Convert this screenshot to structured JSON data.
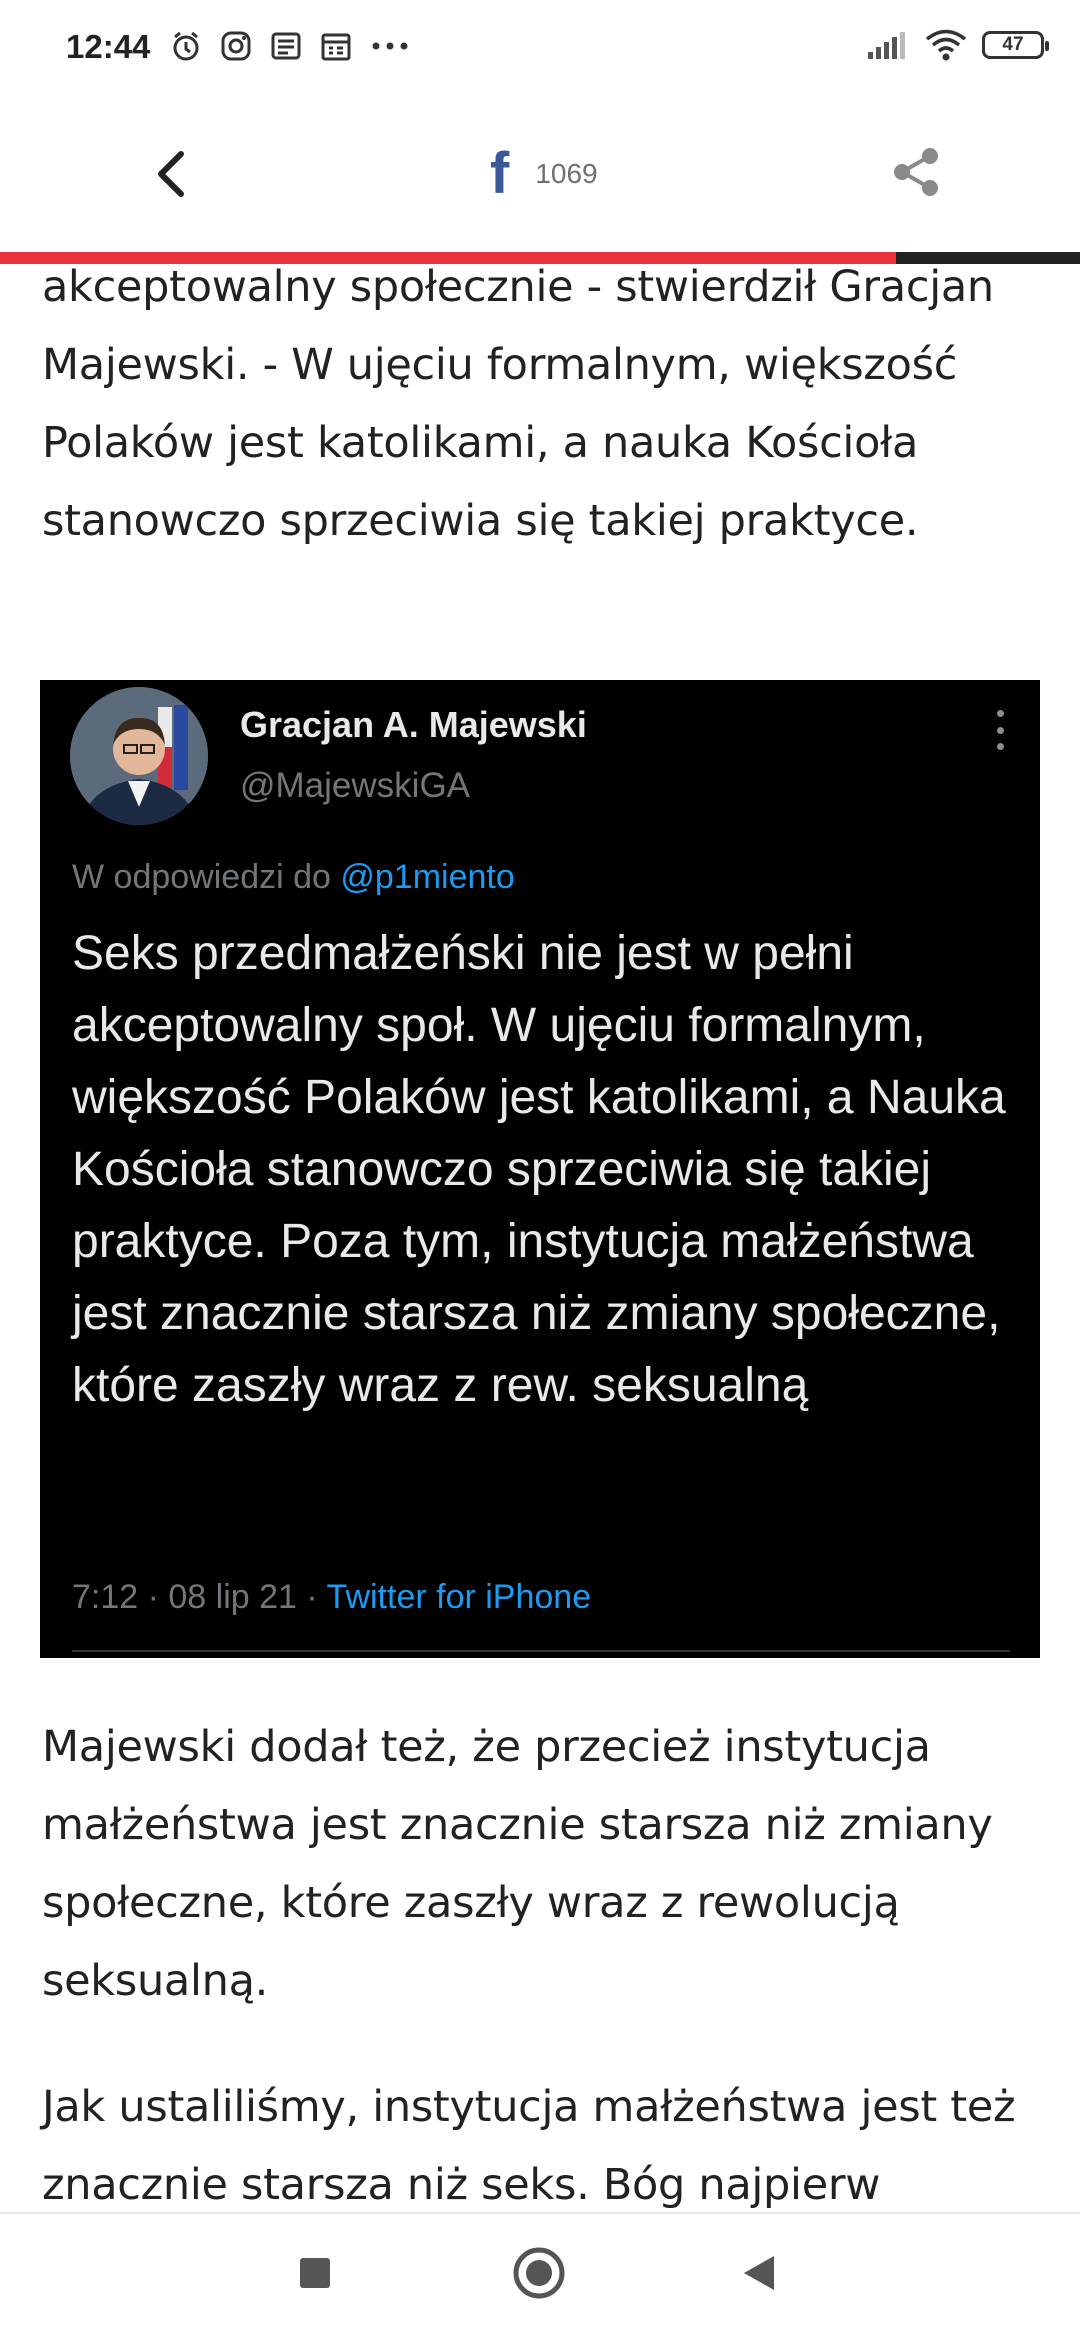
{
  "status_bar": {
    "time": "12:44",
    "battery": "47",
    "left_icons": [
      "alarm-icon",
      "instagram-icon",
      "news-icon",
      "calendar-icon",
      "more-dots-icon"
    ],
    "right_icons": [
      "signal-icon",
      "wifi-icon",
      "battery-icon"
    ]
  },
  "app_bar": {
    "facebook_letter": "f",
    "facebook_count": "1069",
    "progress_percent": 83,
    "accent_color": "#e8333d"
  },
  "article": {
    "paragraph_1": "akceptowalny społecznie - stwierdził Gracjan Majewski. - W ujęciu formalnym, większość Polaków jest katolikami, a nauka Kościoła stanowczo sprzeciwia się takiej praktyce.",
    "paragraph_2": "Majewski dodał też, że przecież instytucja małżeństwa jest znacznie starsza niż zmiany społeczne, które zaszły wraz z rewolucją seksualną.",
    "paragraph_3": "Jak ustaliliśmy, instytucja małżeństwa jest też znacznie starsza niż seks. Bóg najpierw"
  },
  "tweet": {
    "name": "Gracjan A. Majewski",
    "handle": "@MajewskiGA",
    "reply_prefix": "W odpowiedzi do",
    "reply_mention": "@p1miento",
    "text": "Seks przedmałżeński nie jest w pełni akceptowalny społ. W ujęciu formalnym, większość Polaków jest katolikami, a Nauka Kościoła stanowczo sprzeciwia się takiej praktyce. Poza tym, instytucja małżeństwa jest znacznie starsza niż zmiany społeczne, które zaszły wraz z rew. seksualną",
    "timestamp": "7:12 · 08 lip 21 ·",
    "source": "Twitter for iPhone",
    "link_color": "#1d9bf0"
  }
}
